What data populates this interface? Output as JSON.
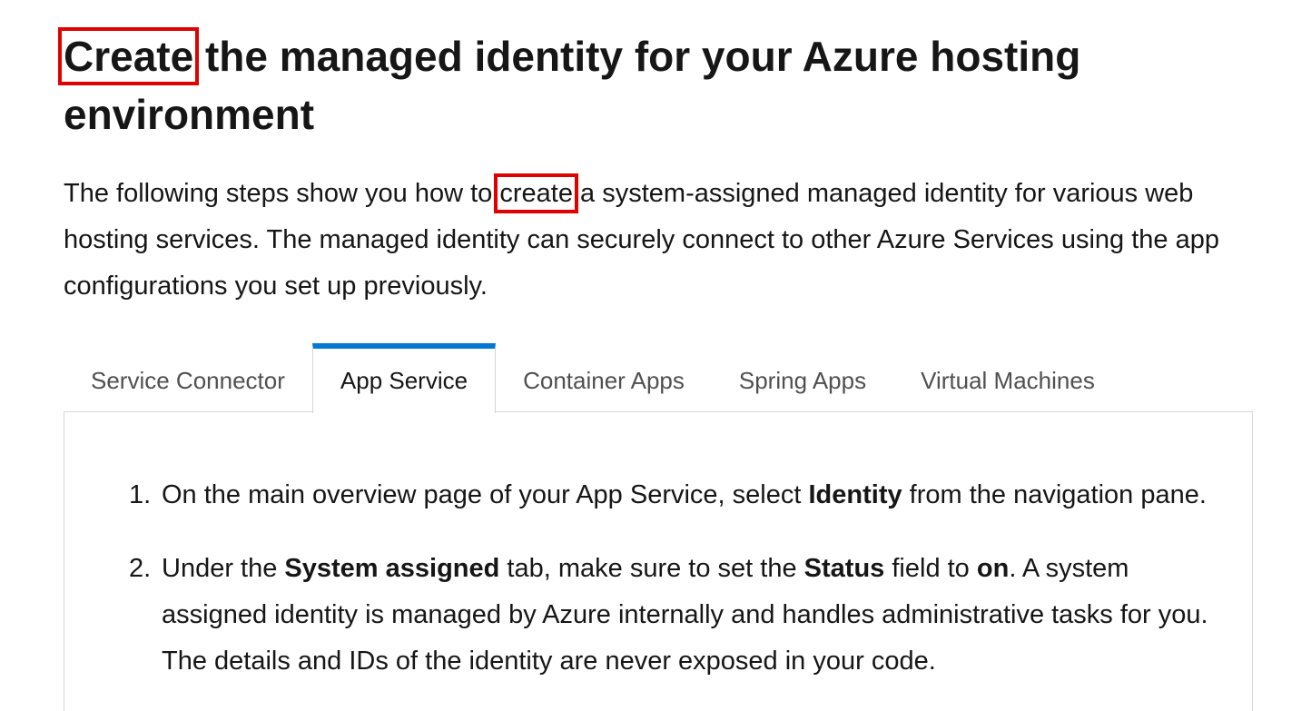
{
  "title": {
    "highlighted_word": "Create",
    "rest": " the managed identity for your Azure hosting environment"
  },
  "intro": {
    "before": "The following steps show you how to ",
    "highlighted_word": "create",
    "after": " a system-assigned managed identity for various web hosting services. The managed identity can securely connect to other Azure Services using the app configurations you set up previously."
  },
  "highlight_color": "#e00000",
  "accent_color": "#0078d4",
  "tabs": [
    {
      "label": "Service Connector",
      "active": false
    },
    {
      "label": "App Service",
      "active": true
    },
    {
      "label": "Container Apps",
      "active": false
    },
    {
      "label": "Spring Apps",
      "active": false
    },
    {
      "label": "Virtual Machines",
      "active": false
    }
  ],
  "steps": [
    {
      "number": "1.",
      "t1": "On the main overview page of your App Service, select ",
      "b1": "Identity",
      "t2": " from the navigation pane."
    },
    {
      "number": "2.",
      "t1": "Under the ",
      "b1": "System assigned",
      "t2": " tab, make sure to set the ",
      "b2": "Status",
      "t3": " field to ",
      "b3": "on",
      "t4": ". A system assigned identity is managed by Azure internally and handles administrative tasks for you. The details and IDs of the identity are never exposed in your code."
    }
  ]
}
